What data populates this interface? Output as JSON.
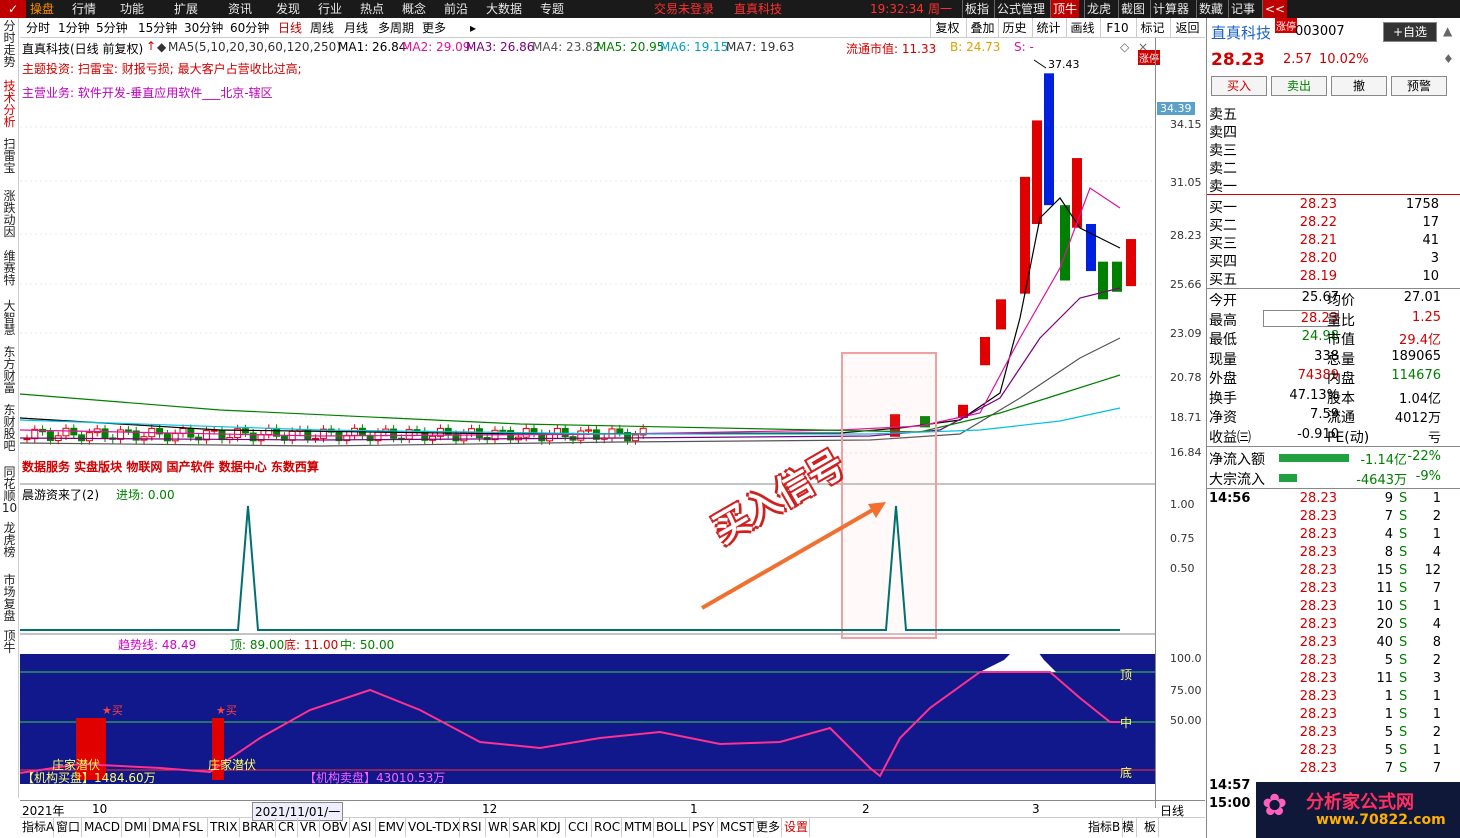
{
  "menu": {
    "logo": "操盘",
    "items": [
      "行情",
      "功能",
      "扩展",
      "资讯",
      "发现",
      "行业",
      "热点",
      "概念",
      "前沿",
      "大数据",
      "专题"
    ],
    "status": "交易未登录",
    "brand": "直真科技",
    "time": "19:32:34",
    "weekday": "周一",
    "right": [
      "板指",
      "公式管理",
      "顶牛",
      "龙虎",
      "截图",
      "计算器",
      "数藏",
      "记事"
    ],
    "arrow": "<<"
  },
  "leftnav": [
    "分时走势",
    "技术分析",
    "扫雷宝",
    "涨跌动因",
    "维赛特",
    "大智慧",
    "东方财富",
    "东财股吧",
    "同花顺10",
    "龙虎榜",
    "市场复盘",
    "顶牛"
  ],
  "periods": [
    "分时",
    "1分钟",
    "5分钟",
    "15分钟",
    "30分钟",
    "60分钟",
    "日线",
    "周线",
    "月线",
    "多周期",
    "更多"
  ],
  "active_period": "日线",
  "chart_tools": [
    "复权",
    "叠加",
    "历史",
    "统计",
    "画线",
    "F10",
    "标记",
    "返回"
  ],
  "main": {
    "title": "直真科技(日线 前复权)",
    "ma": {
      "label": "MA5(5,10,20,30,60,120,250)",
      "ma1": "MA1: 26.84",
      "ma2": "MA2: 29.09",
      "ma3": "MA3: 26.86",
      "ma4": "MA4: 23.82",
      "ma5": "MA5: 20.95",
      "ma6": "MA6: 19.15",
      "ma7": "MA7: 19.63"
    },
    "float_mv": "流通市值: 11.33",
    "b": "B: 24.73",
    "s": "S: -",
    "line1": "主题投资:   扫雷宝:   财报亏损; 最大客户占营收比过高;",
    "line2": "主营业务:   软件开发-垂直应用软件___北京-辖区",
    "concept_text": "数据服务 实盘版块 物联网 国产软件 数据中心 东数西算",
    "high_label": "37.43",
    "buy_label": "买入",
    "sell_label": "卖出",
    "zhang": "涨停",
    "markers": [
      "财",
      "减",
      "跌",
      "榜",
      "预"
    ]
  },
  "axis_main": [
    "34.15",
    "31.05",
    "28.23",
    "25.66",
    "23.09",
    "20.78",
    "18.71",
    "16.84"
  ],
  "axis_cursor": "34.39",
  "ind1": {
    "title": "晨游资来了(2)",
    "entry": "进场: 0.00",
    "axis": [
      "1.00",
      "0.75",
      "0.50"
    ]
  },
  "annotation": "买入信号",
  "ind2": {
    "trend": "趋势线: 48.49",
    "top": "顶: 89.00",
    "bottom": "底: 11.00",
    "mid": "中: 50.00",
    "axis": [
      "100.0",
      "75.00",
      "50.00"
    ],
    "ding": "顶",
    "zhong": "中",
    "di": "底",
    "zhuang": "庄家潜伏",
    "buy_star": "★买",
    "ji_buy": "【机构买盘】1484.60万",
    "ji_sell": "【机构卖盘】43010.53万"
  },
  "xaxis": {
    "labels": [
      "2021年",
      "10",
      "11",
      "12",
      "1",
      "2",
      "3"
    ],
    "cursor": "2021/11/01/一",
    "period": "日线"
  },
  "bottom_tabs": [
    "指标A",
    "窗口",
    "MACD",
    "DMI",
    "DMA",
    "FSL",
    "TRIX",
    "BRAR",
    "CR",
    "VR",
    "OBV",
    "ASI",
    "EMV",
    "VOL-TDX",
    "RSI",
    "WR",
    "SAR",
    "KDJ",
    "CCI",
    "ROC",
    "MTM",
    "BOLL",
    "PSY",
    "MCST",
    "更多",
    "设置"
  ],
  "bottom_right": [
    "指标B",
    "模",
    "板"
  ],
  "quote": {
    "name": "直真科技",
    "code": "003007",
    "select": "+自选",
    "price": "28.23",
    "change": "2.57",
    "pct": "10.02%",
    "buy": "买入",
    "sell": "卖出",
    "cancel": "撤",
    "alert": "预警",
    "asks": [
      "卖五",
      "卖四",
      "卖三",
      "卖二",
      "卖一"
    ],
    "bids": [
      {
        "l": "买一",
        "p": "28.23",
        "v": "1758"
      },
      {
        "l": "买二",
        "p": "28.22",
        "v": "17"
      },
      {
        "l": "买三",
        "p": "28.21",
        "v": "41"
      },
      {
        "l": "买四",
        "p": "28.20",
        "v": "3"
      },
      {
        "l": "买五",
        "p": "28.19",
        "v": "10"
      }
    ],
    "stats": [
      [
        "今开",
        "25.67",
        "均价",
        "27.01"
      ],
      [
        "最高",
        "28.23",
        "量比",
        "1.25"
      ],
      [
        "最低",
        "24.98",
        "市值",
        "29.4亿"
      ],
      [
        "现量",
        "338",
        "总量",
        "189065"
      ],
      [
        "外盘",
        "74389",
        "内盘",
        "114676"
      ],
      [
        "换手",
        "47.13%",
        "股本",
        "1.04亿"
      ],
      [
        "净资",
        "7.59",
        "流通",
        "4012万"
      ],
      [
        "收益㈢",
        "-0.910",
        "PE(动)",
        "亏"
      ]
    ],
    "flows": [
      [
        "净流入额",
        "-1.14亿",
        "-22%"
      ],
      [
        "大宗流入",
        "-4643万",
        "-9%"
      ]
    ],
    "ticks_time": "14:56",
    "ticks": [
      [
        "28.23",
        "9",
        "1"
      ],
      [
        "28.23",
        "7",
        "2"
      ],
      [
        "28.23",
        "4",
        "1"
      ],
      [
        "28.23",
        "8",
        "4"
      ],
      [
        "28.23",
        "15",
        "12"
      ],
      [
        "28.23",
        "11",
        "7"
      ],
      [
        "28.23",
        "10",
        "1"
      ],
      [
        "28.23",
        "20",
        "4"
      ],
      [
        "28.23",
        "40",
        "8"
      ],
      [
        "28.23",
        "5",
        "2"
      ],
      [
        "28.23",
        "11",
        "3"
      ],
      [
        "28.23",
        "1",
        "1"
      ],
      [
        "28.23",
        "1",
        "1"
      ],
      [
        "28.23",
        "5",
        "2"
      ],
      [
        "28.23",
        "5",
        "1"
      ],
      [
        "28.23",
        "7",
        "7"
      ]
    ],
    "tick_side": "S",
    "time_end1": "14:57",
    "time_end2": "15:00"
  },
  "watermark": {
    "title": "分析家公式网",
    "url": "www.70822.com"
  }
}
